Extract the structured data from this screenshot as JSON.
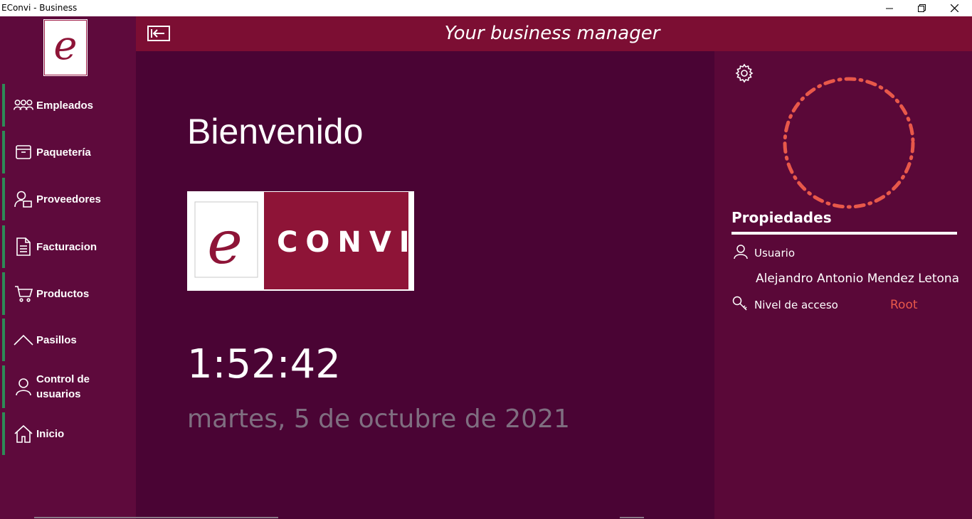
{
  "window": {
    "title": "EConvi - Business",
    "minimize_icon": "minimize-icon",
    "maximize_icon": "restore-icon",
    "close_icon": "close-icon"
  },
  "header": {
    "tagline": "Your business manager",
    "back_icon": "collapse-arrow-icon"
  },
  "sidebar": {
    "logo_text": "e",
    "items": [
      {
        "label": "Empleados",
        "icon": "people-icon"
      },
      {
        "label": "Paquetería",
        "icon": "box-icon"
      },
      {
        "label": "Proveedores",
        "icon": "supplier-icon"
      },
      {
        "label": "Facturacion",
        "icon": "document-icon"
      },
      {
        "label": "Productos",
        "icon": "cart-icon"
      },
      {
        "label": "Pasillos",
        "icon": "chevron-up-icon"
      },
      {
        "label": "Control de usuarios",
        "icon": "user-icon"
      },
      {
        "label": "Inicio",
        "icon": "home-icon"
      }
    ]
  },
  "main": {
    "welcome": "Bienvenido",
    "brand": "CONVI",
    "brand_logo_letter": "e",
    "time": "1:52:42",
    "date": "martes, 5 de octubre de 2021"
  },
  "panel": {
    "settings_icon": "gear-icon",
    "loading_indicator": "spinner",
    "title": "Propiedades",
    "user_label": "Usuario",
    "user_name": "Alejandro Antonio Mendez Letona",
    "access_label": "Nivel de acceso",
    "access_value": "Root"
  },
  "colors": {
    "sidebar": "#5e0a3c",
    "header": "#7c0e33",
    "main": "#4a0434",
    "panel": "#5a0838",
    "accent_green": "#2e8b57",
    "accent_red": "#e8584a"
  }
}
